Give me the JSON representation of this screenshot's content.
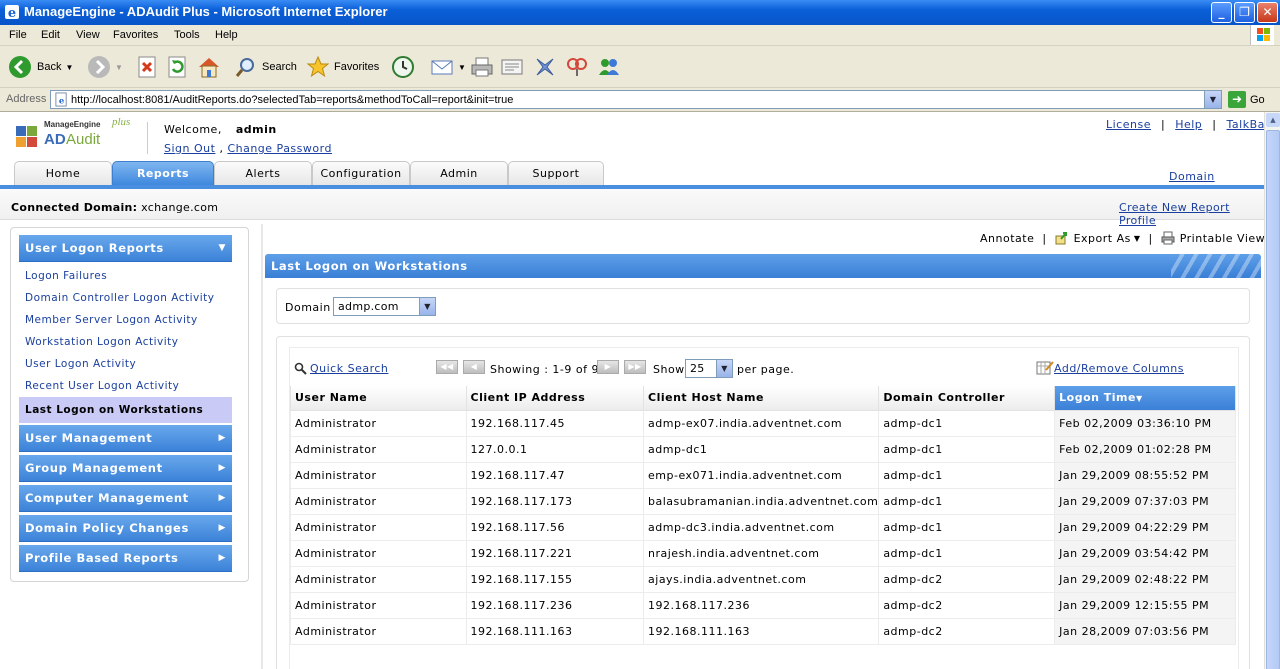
{
  "window": {
    "title": "ManageEngine - ADAudit Plus - Microsoft Internet Explorer"
  },
  "menu": [
    "File",
    "Edit",
    "View",
    "Favorites",
    "Tools",
    "Help"
  ],
  "toolbar": {
    "back": "Back",
    "search": "Search",
    "favorites": "Favorites"
  },
  "address": {
    "label": "Address",
    "url": "http://localhost:8081/AuditReports.do?selectedTab=reports&methodToCall=report&init=true",
    "go": "Go"
  },
  "header": {
    "logo_company": "ManageEngine",
    "logo_plus": "plus",
    "logo_ad": "AD",
    "logo_audit": "Audit",
    "welcome": "Welcome,",
    "user": "admin",
    "sign_out": "Sign Out",
    "comma": ",",
    "change_password": "Change Password",
    "license": "License",
    "help": "Help",
    "talkback": "TalkBack",
    "pipe": "|"
  },
  "tabs": [
    "Home",
    "Reports",
    "Alerts",
    "Configuration",
    "Admin",
    "Support"
  ],
  "active_tab": "Reports",
  "domain_settings": "Domain Settings",
  "connbar": {
    "label": "Connected Domain:",
    "domain": "xchange.com",
    "create_profile": "Create New Report Profile"
  },
  "sidebar": {
    "sections": [
      {
        "label": "User Logon Reports",
        "expanded": true
      },
      {
        "label": "User Management"
      },
      {
        "label": "Group Management"
      },
      {
        "label": "Computer Management"
      },
      {
        "label": "Domain Policy Changes"
      },
      {
        "label": "Profile Based Reports"
      }
    ],
    "items": [
      "Logon Failures",
      "Domain Controller Logon Activity",
      "Member Server Logon Activity",
      "Workstation Logon Activity",
      "User Logon Activity",
      "Recent User Logon Activity",
      "Last Logon on Workstations"
    ],
    "active_item": "Last Logon on Workstations"
  },
  "actions": {
    "annotate": "Annotate",
    "export_as": "Export As",
    "printable_view": "Printable View",
    "pipe": "|"
  },
  "panel": {
    "title": "Last Logon on Workstations",
    "domain_label": "Domain",
    "domain_value": "admp.com"
  },
  "pager": {
    "quick_search": "Quick Search",
    "showing": "Showing : 1-9 of 9",
    "show": "Show",
    "per_page_value": "25",
    "per_page": "per page.",
    "add_remove_columns": "Add/Remove Columns"
  },
  "table": {
    "columns": [
      "User Name",
      "Client IP Address",
      "Client Host Name",
      "Domain Controller",
      "Logon Time"
    ],
    "sorted_column": "Logon Time",
    "rows": [
      [
        "Administrator",
        "192.168.117.45",
        "admp-ex07.india.adventnet.com",
        "admp-dc1",
        "Feb 02,2009 03:36:10 PM"
      ],
      [
        "Administrator",
        "127.0.0.1",
        "admp-dc1",
        "admp-dc1",
        "Feb 02,2009 01:02:28 PM"
      ],
      [
        "Administrator",
        "192.168.117.47",
        "emp-ex071.india.adventnet.com",
        "admp-dc1",
        "Jan 29,2009 08:55:52 PM"
      ],
      [
        "Administrator",
        "192.168.117.173",
        "balasubramanian.india.adventnet.com",
        "admp-dc1",
        "Jan 29,2009 07:37:03 PM"
      ],
      [
        "Administrator",
        "192.168.117.56",
        "admp-dc3.india.adventnet.com",
        "admp-dc1",
        "Jan 29,2009 04:22:29 PM"
      ],
      [
        "Administrator",
        "192.168.117.221",
        "nrajesh.india.adventnet.com",
        "admp-dc1",
        "Jan 29,2009 03:54:42 PM"
      ],
      [
        "Administrator",
        "192.168.117.155",
        "ajays.india.adventnet.com",
        "admp-dc2",
        "Jan 29,2009 02:48:22 PM"
      ],
      [
        "Administrator",
        "192.168.117.236",
        "192.168.117.236",
        "admp-dc2",
        "Jan 29,2009 12:15:55 PM"
      ],
      [
        "Administrator",
        "192.168.111.163",
        "192.168.111.163",
        "admp-dc2",
        "Jan 28,2009 07:03:56 PM"
      ]
    ]
  },
  "colors": {
    "accent": "#3b82d8",
    "link": "#1a3f9e",
    "active_item_bg": "#c9caf5"
  }
}
